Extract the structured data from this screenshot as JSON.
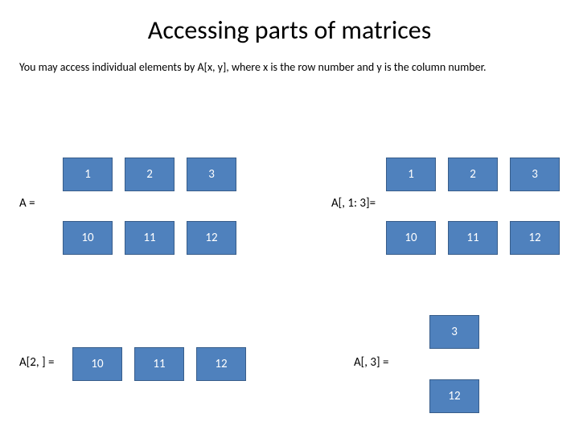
{
  "title": "Accessing parts of matrices",
  "description": "You may access individual elements by A[x, y], where x is the row number and y is the column number.",
  "labels": {
    "A": "A =",
    "A13": "A[, 1: 3]=",
    "A2": "A[2, ] =",
    "A3": "A[, 3] ="
  },
  "matrixA": {
    "row1": [
      "1",
      "2",
      "3"
    ],
    "row2": [
      "10",
      "11",
      "12"
    ]
  },
  "matrixA13": {
    "row1": [
      "1",
      "2",
      "3"
    ],
    "row2": [
      "10",
      "11",
      "12"
    ]
  },
  "matrixA2": [
    "10",
    "11",
    "12"
  ],
  "matrixA3": [
    "3",
    "12"
  ]
}
